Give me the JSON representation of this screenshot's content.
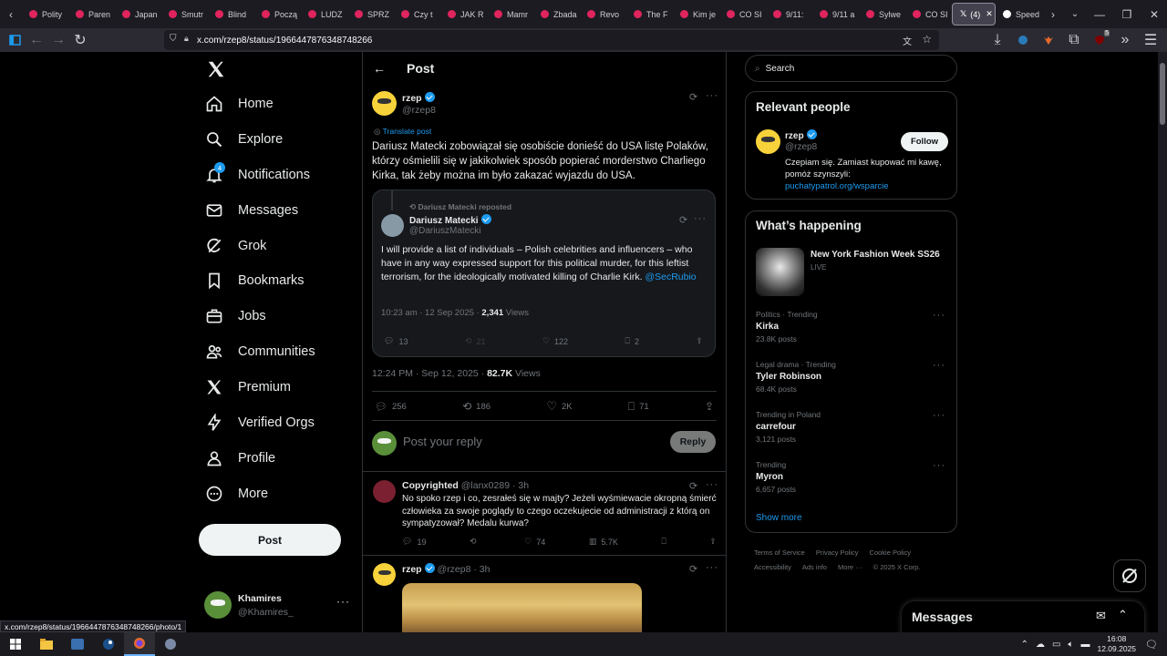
{
  "browser": {
    "tabs": [
      {
        "label": "Polity"
      },
      {
        "label": "Paren"
      },
      {
        "label": "Japan"
      },
      {
        "label": "Smutr"
      },
      {
        "label": "Blind"
      },
      {
        "label": "Począ"
      },
      {
        "label": "LUDZ"
      },
      {
        "label": "SPRZ"
      },
      {
        "label": "Czy t"
      },
      {
        "label": "JAK R"
      },
      {
        "label": "Mamr"
      },
      {
        "label": "Zbada"
      },
      {
        "label": "Revo"
      },
      {
        "label": "The F"
      },
      {
        "label": "Kim je"
      },
      {
        "label": "CO SI"
      },
      {
        "label": "9/11:"
      },
      {
        "label": "9/11 a"
      },
      {
        "label": "Sylwe"
      },
      {
        "label": "CO SI"
      }
    ],
    "active_tab": {
      "label": "(4)"
    },
    "speed_tab": {
      "label": "Speed"
    },
    "url": "x.com/rzep8/status/1966447876348748266",
    "status_url": "x.com/rzep8/status/1966447876348748266/photo/1",
    "notif_badge": "5"
  },
  "nav": {
    "items": [
      {
        "label": "Home",
        "icon": "home-icon"
      },
      {
        "label": "Explore",
        "icon": "search-icon"
      },
      {
        "label": "Notifications",
        "icon": "bell-icon"
      },
      {
        "label": "Messages",
        "icon": "mail-icon"
      },
      {
        "label": "Grok",
        "icon": "grok-icon"
      },
      {
        "label": "Bookmarks",
        "icon": "bookmark-icon"
      },
      {
        "label": "Jobs",
        "icon": "briefcase-icon"
      },
      {
        "label": "Communities",
        "icon": "people-icon"
      },
      {
        "label": "Premium",
        "icon": "x-logo-icon"
      },
      {
        "label": "Verified Orgs",
        "icon": "lightning-icon"
      },
      {
        "label": "Profile",
        "icon": "person-icon"
      },
      {
        "label": "More",
        "icon": "more-circle-icon"
      }
    ],
    "notif_count": "4",
    "post_label": "Post",
    "account": {
      "name": "Khamires",
      "handle": "@Khamires_"
    }
  },
  "post": {
    "header": "Post",
    "author": {
      "name": "rzep",
      "handle": "@rzep8"
    },
    "translate": "Translate post",
    "text": "Dariusz Matecki zobowiązał się osobiście donieść do USA listę Polaków, którzy ośmielili się w jakikolwiek sposób popierać morderstwo Charliego Kirka, tak żeby można im było zakazać wyjazdu do USA.",
    "quote": {
      "reposted": "Dariusz Matecki reposted",
      "name": "Dariusz Matecki",
      "handle": "@DariuszMatecki",
      "text": "I will provide a list of individuals – Polish celebrities and influencers – who have in any way expressed support for this political murder, for this leftist terrorism, for the ideologically motivated killing of Charlie Kirk.",
      "mention": "@SecRubio",
      "time": "10:23 am · 12 Sep 2025 · ",
      "views_count": "2,341",
      "views_label": " Views",
      "replies": "13",
      "reposts": "21",
      "likes": "122",
      "bookmarks": "2"
    },
    "meta_time": "12:24 PM · Sep 12, 2025 · ",
    "meta_views": "82.7K",
    "meta_views_label": " Views",
    "stats": {
      "replies": "256",
      "reposts": "186",
      "likes": "2K",
      "bookmarks": "71"
    },
    "reply_placeholder": "Post your reply",
    "reply_button": "Reply"
  },
  "replies": [
    {
      "name": "Copyrighted",
      "handle": "@lanx0289",
      "time": "· 3h",
      "text": "No spoko rzep i co, zesrałeś się w majty? Jeżeli wyśmiewacie okropną śmierć człowieka za swoje poglądy to czego oczekujecie od administracji z którą on sympatyzował? Medalu kurwa?",
      "replies": "19",
      "reposts": "",
      "likes": "74",
      "views": "5.7K"
    },
    {
      "name": "rzep",
      "handle": "@rzep8",
      "time": "· 3h"
    }
  ],
  "right": {
    "search_placeholder": "Search",
    "relevant_title": "Relevant people",
    "person": {
      "name": "rzep",
      "handle": "@rzep8",
      "follow": "Follow",
      "bio": "Czepiam się. Zamiast kupować mi kawę, pomóż szynszyli:",
      "link": "puchatypatrol.org/wsparcie"
    },
    "happening_title": "What’s happening",
    "event": {
      "title": "New York Fashion Week SS26",
      "tag": "LIVE"
    },
    "trends": [
      {
        "context": "Politics · Trending",
        "name": "Kirka",
        "count": "23.8K posts"
      },
      {
        "context": "Legal drama · Trending",
        "name": "Tyler Robinson",
        "count": "68.4K posts"
      },
      {
        "context": "Trending in Poland",
        "name": "carrefour",
        "count": "3,121 posts"
      },
      {
        "context": "Trending",
        "name": "Myron",
        "count": "6,657 posts"
      }
    ],
    "show_more": "Show more",
    "footer": [
      "Terms of Service",
      "Privacy Policy",
      "Cookie Policy",
      "Accessibility",
      "Ads info",
      "More ···",
      "© 2025 X Corp."
    ],
    "messages": "Messages"
  },
  "taskbar": {
    "time": "16:08",
    "date": "12.09.2025"
  },
  "colors": {
    "accent": "#1d9bf0",
    "bg": "#000000",
    "border": "#2f3336",
    "muted": "#71767b"
  }
}
